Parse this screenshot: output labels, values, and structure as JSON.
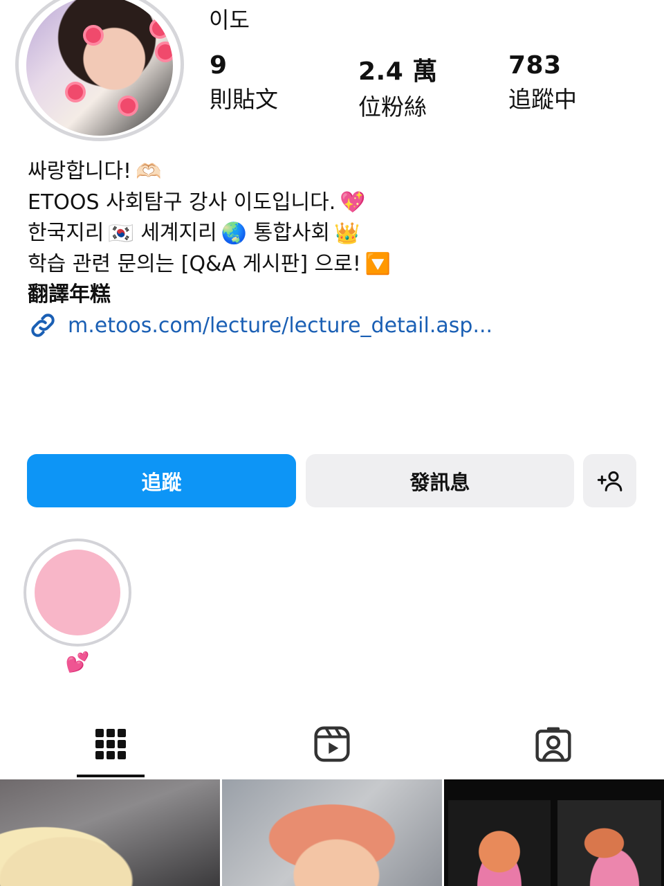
{
  "profile": {
    "username": "이도",
    "stats": [
      {
        "value": "9",
        "label": "則貼文"
      },
      {
        "value": "2.4 萬",
        "label": "位粉絲"
      },
      {
        "value": "783",
        "label": "追蹤中"
      }
    ]
  },
  "bio": {
    "line1": "싸랑합니다!",
    "line1_emoji": "🫶🏻",
    "line2": "ETOOS 사회탐구 강사 이도입니다.",
    "line2_emoji": "💖",
    "line3_a": "한국지리",
    "line3_flag": "🇰🇷",
    "line3_b": "세계지리",
    "line3_globe": "🌏",
    "line3_c": "통합사회",
    "line3_crown": "👑",
    "line4": "학습 관련 문의는 [Q&A 게시판] 으로!",
    "line4_emoji": "🔽",
    "translate": "翻譯年糕",
    "link": "m.etoos.com/lecture/lecture_detail.asp..."
  },
  "buttons": {
    "follow": "追蹤",
    "message": "發訊息"
  },
  "highlight": {
    "label": "💕"
  },
  "icons": {
    "link": "link-icon",
    "add_person": "add-person-icon",
    "grid": "grid-icon",
    "reels": "reels-icon",
    "tagged": "tagged-icon"
  },
  "colors": {
    "follow_button": "#0d95f6",
    "secondary_button": "#efeff1",
    "link": "#1a5fb4",
    "highlight_fill": "#f8b6c8"
  }
}
